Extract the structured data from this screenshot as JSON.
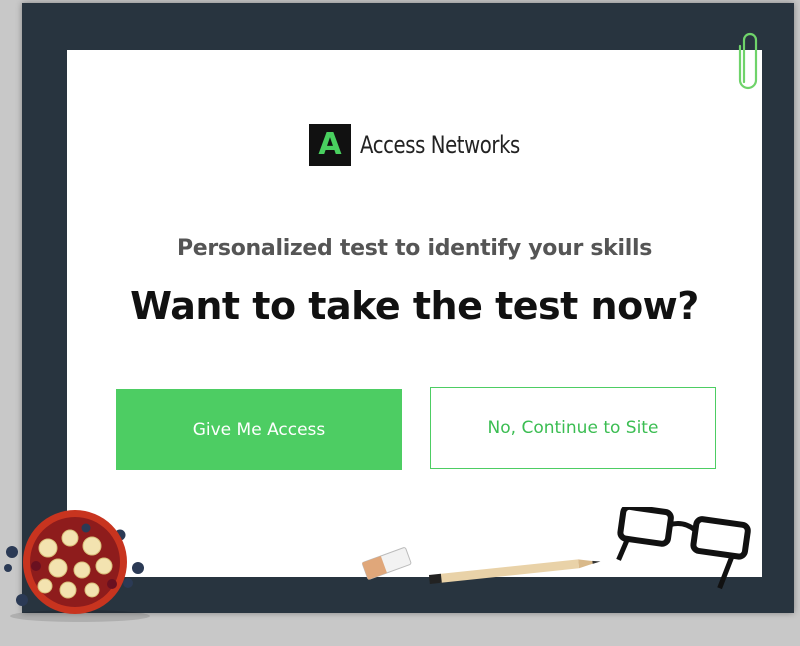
{
  "brand": {
    "mark_letter": "A",
    "name": "Access Networks",
    "mark_color": "#49d05f"
  },
  "popup": {
    "subtitle": "Personalized test to identify your skills",
    "headline": "Want to take the test now?"
  },
  "buttons": {
    "primary_label": "Give Me Access",
    "secondary_label": "No, Continue to Site"
  },
  "colors": {
    "accent": "#4dcd63",
    "frame": "#28343f",
    "background": "#c8c8c8"
  },
  "decorations": [
    "paperclip-icon",
    "fruit-bowl",
    "eraser",
    "pencil",
    "eyeglasses"
  ]
}
